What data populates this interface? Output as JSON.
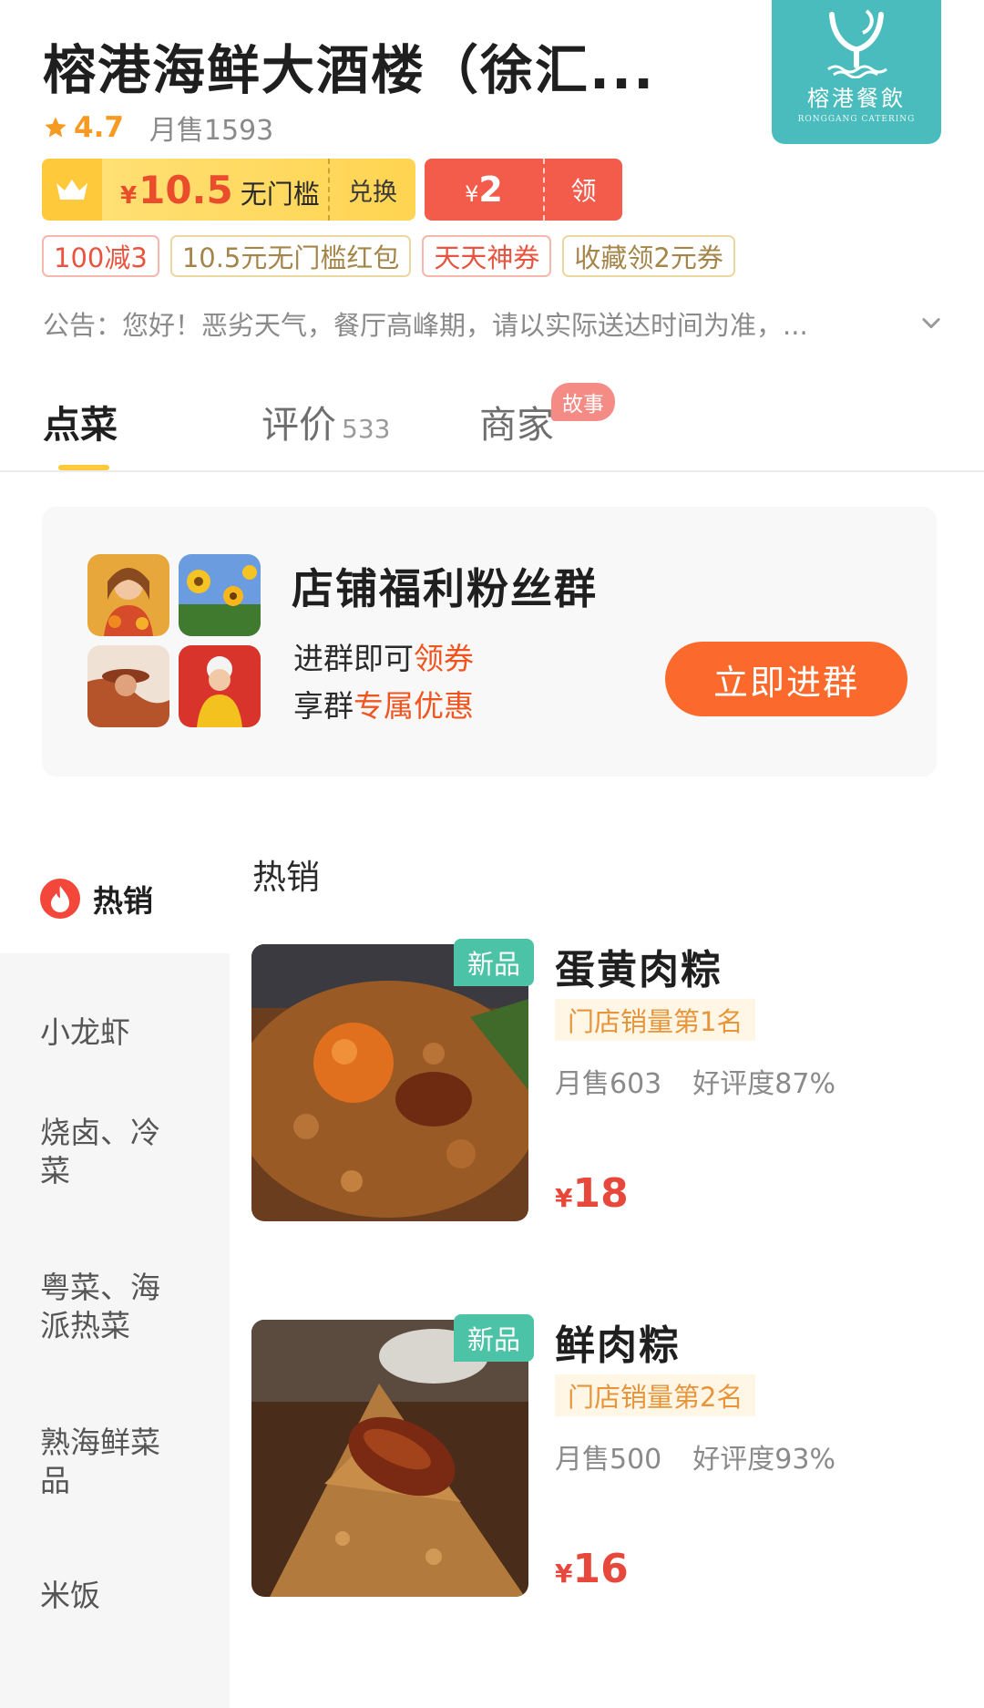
{
  "store": {
    "name": "榕港海鲜大酒楼（徐汇...",
    "rating": "4.7",
    "monthly_sales": "月售1593",
    "logo": {
      "cn": "榕港餐飲",
      "en": "RONGGANG CATERING"
    }
  },
  "coupons": {
    "member": {
      "currency": "¥",
      "amount": "10.5",
      "condition": "无门槛",
      "action": "兑换"
    },
    "red": {
      "currency": "¥",
      "amount": "2",
      "action": "领"
    }
  },
  "promo_tags": [
    {
      "label": "100减3",
      "color": "red"
    },
    {
      "label": "10.5元无门槛红包",
      "color": "gold"
    },
    {
      "label": "天天神券",
      "color": "red"
    },
    {
      "label": "收藏领2元券",
      "color": "gold"
    }
  ],
  "notice": "公告：您好！恶劣天气，餐厅高峰期，请以实际送达时间为准，...",
  "tabs": [
    {
      "label": "点菜",
      "active": true
    },
    {
      "label": "评价",
      "count": "533"
    },
    {
      "label": "商家",
      "badge": "故事"
    }
  ],
  "fan_group": {
    "title": "店铺福利粉丝群",
    "line1_prefix": "进群即可",
    "line1_highlight": "领券",
    "line2_prefix": "享群",
    "line2_highlight": "专属优惠",
    "button": "立即进群"
  },
  "sidebar": {
    "hot": "热销",
    "categories": [
      "小龙虾",
      "烧卤、冷菜",
      "粤菜、海派热菜",
      "熟海鲜菜品",
      "米饭"
    ]
  },
  "section_title": "热销",
  "products": [
    {
      "badge": "新品",
      "name": "蛋黄肉粽",
      "rank": "门店销量第1名",
      "monthly": "月售603",
      "rating": "好评度87%",
      "currency": "¥",
      "price": "18"
    },
    {
      "badge": "新品",
      "name": "鲜肉粽",
      "rank": "门店销量第2名",
      "monthly": "月售500",
      "rating": "好评度93%",
      "currency": "¥",
      "price": "16"
    }
  ],
  "colors": {
    "accent": "#fb6a2c",
    "price": "#e8483b",
    "rating": "#f59a23",
    "brand_teal": "#4bbcbd",
    "new_badge": "#4cc2a6"
  }
}
